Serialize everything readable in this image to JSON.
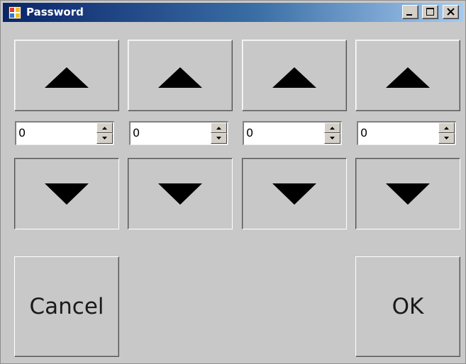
{
  "window": {
    "title": "Password",
    "title_gradient": [
      "#0a246a",
      "#3a6ea5",
      "#a6caf0"
    ],
    "background": "#c8c8c8",
    "icon": "app-window-icon",
    "caption_buttons": [
      "minimize-icon",
      "maximize-icon",
      "close-icon"
    ]
  },
  "digits": [
    {
      "value": "0",
      "up_icon": "triangle-up-icon",
      "down_icon": "triangle-down-icon"
    },
    {
      "value": "0",
      "up_icon": "triangle-up-icon",
      "down_icon": "triangle-down-icon"
    },
    {
      "value": "0",
      "up_icon": "triangle-up-icon",
      "down_icon": "triangle-down-icon"
    },
    {
      "value": "0",
      "up_icon": "triangle-up-icon",
      "down_icon": "triangle-down-icon"
    }
  ],
  "buttons": {
    "cancel_label": "Cancel",
    "ok_label": "OK"
  }
}
